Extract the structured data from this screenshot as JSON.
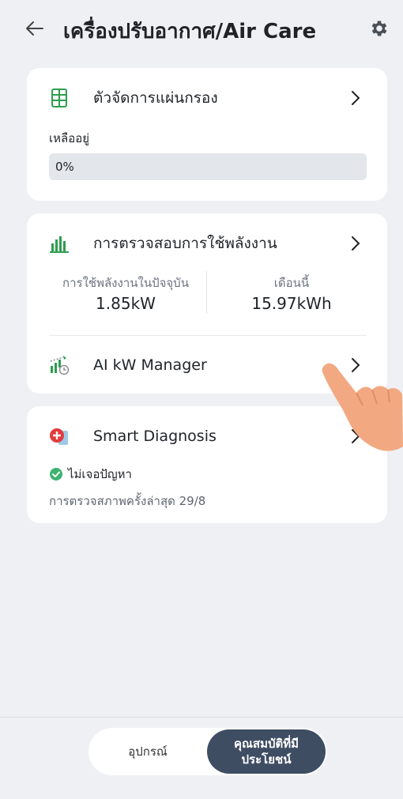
{
  "header": {
    "title": "เครื่องปรับอากาศ/Air Care",
    "back_icon": "arrow-left-icon",
    "settings_icon": "gear-icon"
  },
  "filter_card": {
    "title": "ตัวจัดการแผ่นกรอง",
    "remaining_label": "เหลืออยู่",
    "progress_text": "0%",
    "progress_value": 0
  },
  "energy_card": {
    "title": "การตรวจสอบการใช้พลังงาน",
    "current_label": "การใช้พลังงานในปัจจุบัน",
    "current_value": "1.85kW",
    "month_label": "เดือนนี้",
    "month_value": "15.97kWh",
    "ai_label": "AI kW Manager"
  },
  "diagnosis_card": {
    "title": "Smart Diagnosis",
    "status": "ไม่เจอปัญหา",
    "last_check": "การตรวจสภาพครั้งล่าสุด 29/8"
  },
  "bottom_nav": {
    "left_tab": "อุปกรณ์",
    "right_tab_line1": "คุณสมบัติที่มี",
    "right_tab_line2": "ประโยชน์"
  },
  "colors": {
    "background": "#eef0f3",
    "card": "#ffffff",
    "accent_green": "#2e9e4f",
    "active_tab": "#3f4d63",
    "diagnosis_red": "#e23b3b",
    "check_green": "#3cb371"
  }
}
